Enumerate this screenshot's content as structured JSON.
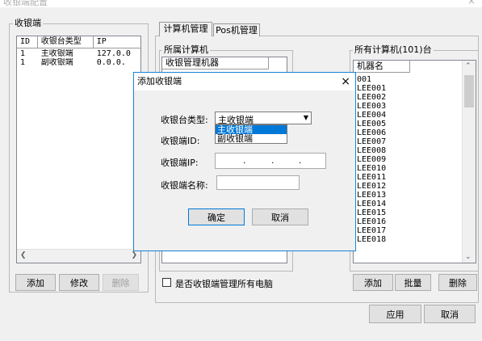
{
  "window": {
    "title": "收银端配置",
    "close_glyph": "×"
  },
  "left_group": {
    "title": "收银端",
    "columns": [
      "ID",
      "收银台类型",
      "IP"
    ],
    "rows": [
      {
        "id": "1",
        "type": "主收银端",
        "ip": "127.0.0"
      },
      {
        "id": "1",
        "type": "副收银端",
        "ip": "0.0.0."
      }
    ],
    "add_label": "添加",
    "edit_label": "修改",
    "delete_label": "删除"
  },
  "tabs": [
    {
      "label": "计算机管理",
      "active": true
    },
    {
      "label": "Pos机管理",
      "active": false
    }
  ],
  "owned_group": {
    "title": "所属计算机",
    "column": "收银管理机器",
    "checkbox_label": "是否收银端管理所有电脑",
    "checked": false
  },
  "all_group": {
    "title": "所有计算机(101)台",
    "column": "机器名",
    "items": [
      "001",
      "LEE001",
      "LEE002",
      "LEE003",
      "LEE004",
      "LEE005",
      "LEE006",
      "LEE007",
      "LEE008",
      "LEE009",
      "LEE010",
      "LEE011",
      "LEE012",
      "LEE013",
      "LEE014",
      "LEE015",
      "LEE016",
      "LEE017",
      "LEE018"
    ],
    "add_label": "添加",
    "batch_label": "批量",
    "delete_label": "删除"
  },
  "footer": {
    "apply_label": "应用",
    "cancel_label": "取消"
  },
  "dialog": {
    "title": "添加收银端",
    "close_glyph": "×",
    "type_label": "收银台类型:",
    "type_value": "主收银端",
    "type_options": [
      "主收银端",
      "副收银端"
    ],
    "id_label": "收银端ID:",
    "ip_label": "收银端IP:",
    "ip_dots": [
      ".",
      ".",
      "."
    ],
    "name_label": "收银端名称:",
    "confirm_label": "确定",
    "cancel_label": "取消"
  },
  "colors": {
    "accent": "#0078d7",
    "selection": "#0078d7",
    "dialog_border": "#1883d7"
  }
}
